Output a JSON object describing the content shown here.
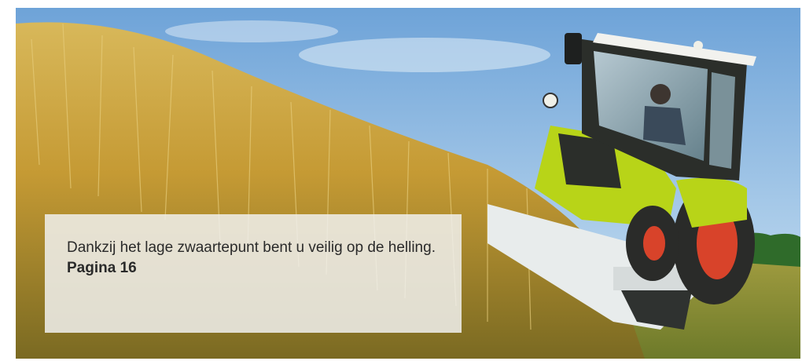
{
  "caption": {
    "text": "Dankzij het lage zwaartepunt bent u veilig op de helling.",
    "page_ref": "Pagina 16"
  },
  "colors": {
    "sky": "#7fb0e0",
    "grass_gold": "#c9a03a",
    "tractor_green": "#b8d418",
    "tractor_dark": "#2b2e2a",
    "wheel_red": "#d8432a",
    "caption_bg": "#f0f0ee"
  }
}
